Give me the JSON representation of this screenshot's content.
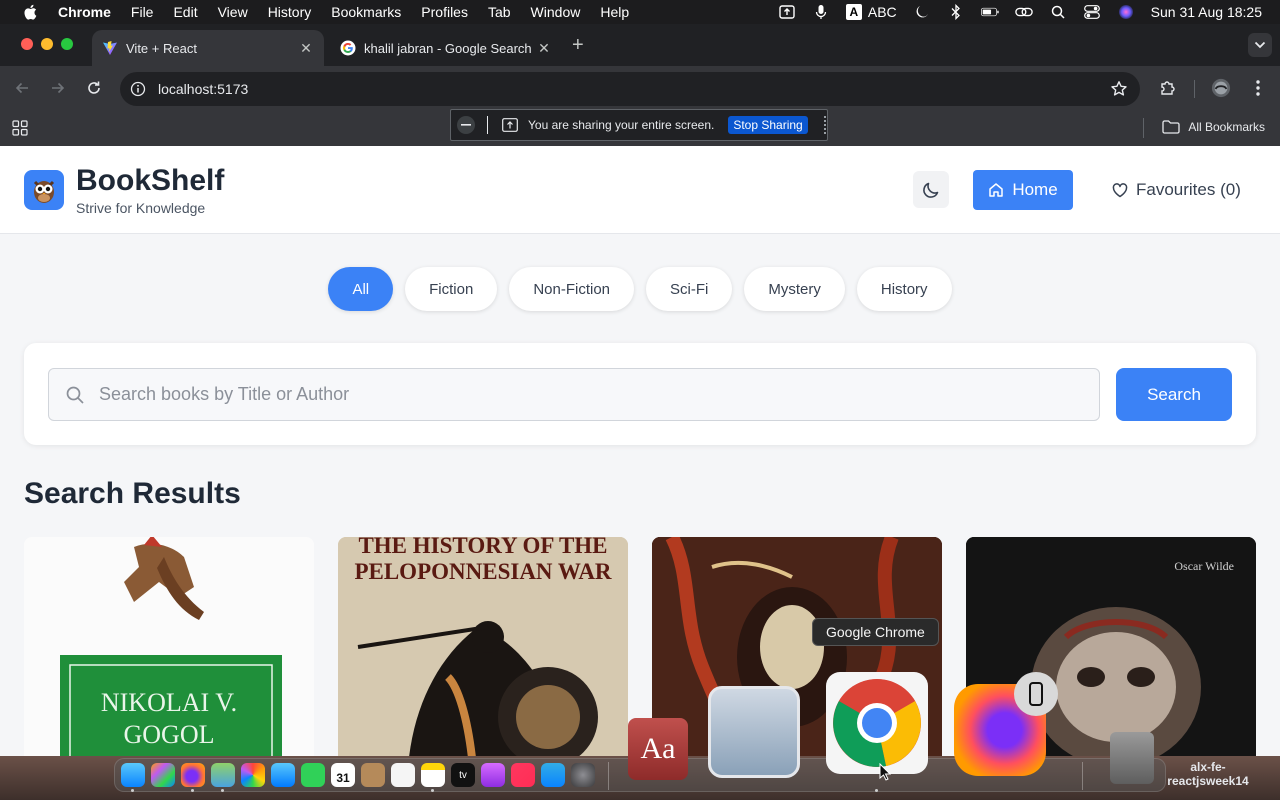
{
  "menubar": {
    "app": "Chrome",
    "items": [
      "File",
      "Edit",
      "View",
      "History",
      "Bookmarks",
      "Profiles",
      "Tab",
      "Window",
      "Help"
    ],
    "input_source": "ABC",
    "datetime": "Sun 31 Aug  18:25"
  },
  "browser": {
    "tabs": [
      {
        "title": "Vite + React",
        "active": true
      },
      {
        "title": "khalil jabran - Google Search",
        "active": false
      }
    ],
    "url": "localhost:5173",
    "all_bookmarks_label": "All Bookmarks",
    "sharing": {
      "message": "You are sharing your entire screen.",
      "stop_label": "Stop Sharing"
    }
  },
  "app": {
    "brand": "BookShelf",
    "tagline": "Strive for Knowledge",
    "nav": {
      "home_label": "Home",
      "favourites_label": "Favourites (0)"
    },
    "categories": [
      "All",
      "Fiction",
      "Non-Fiction",
      "Sci-Fi",
      "Mystery",
      "History"
    ],
    "active_category": "All",
    "search": {
      "placeholder": "Search books by Title or Author",
      "button_label": "Search"
    },
    "results_title": "Search Results",
    "book_cover_text": {
      "book1": "NIKOLAI V. GOGOL",
      "book2": "THE HISTORY OF THE PELOPONNESIAN WAR",
      "book4": "Oscar Wilde"
    }
  },
  "dock": {
    "tooltip": "Google Chrome",
    "folder_label": "alx-fe-reactjsweek14",
    "dictionary_glyph": "Aa",
    "calendar_day": "31"
  },
  "colors": {
    "accent": "#3b82f6",
    "browser_bg": "#202124",
    "toolbar_bg": "#35363a",
    "page_bg": "#f5f6f8"
  }
}
